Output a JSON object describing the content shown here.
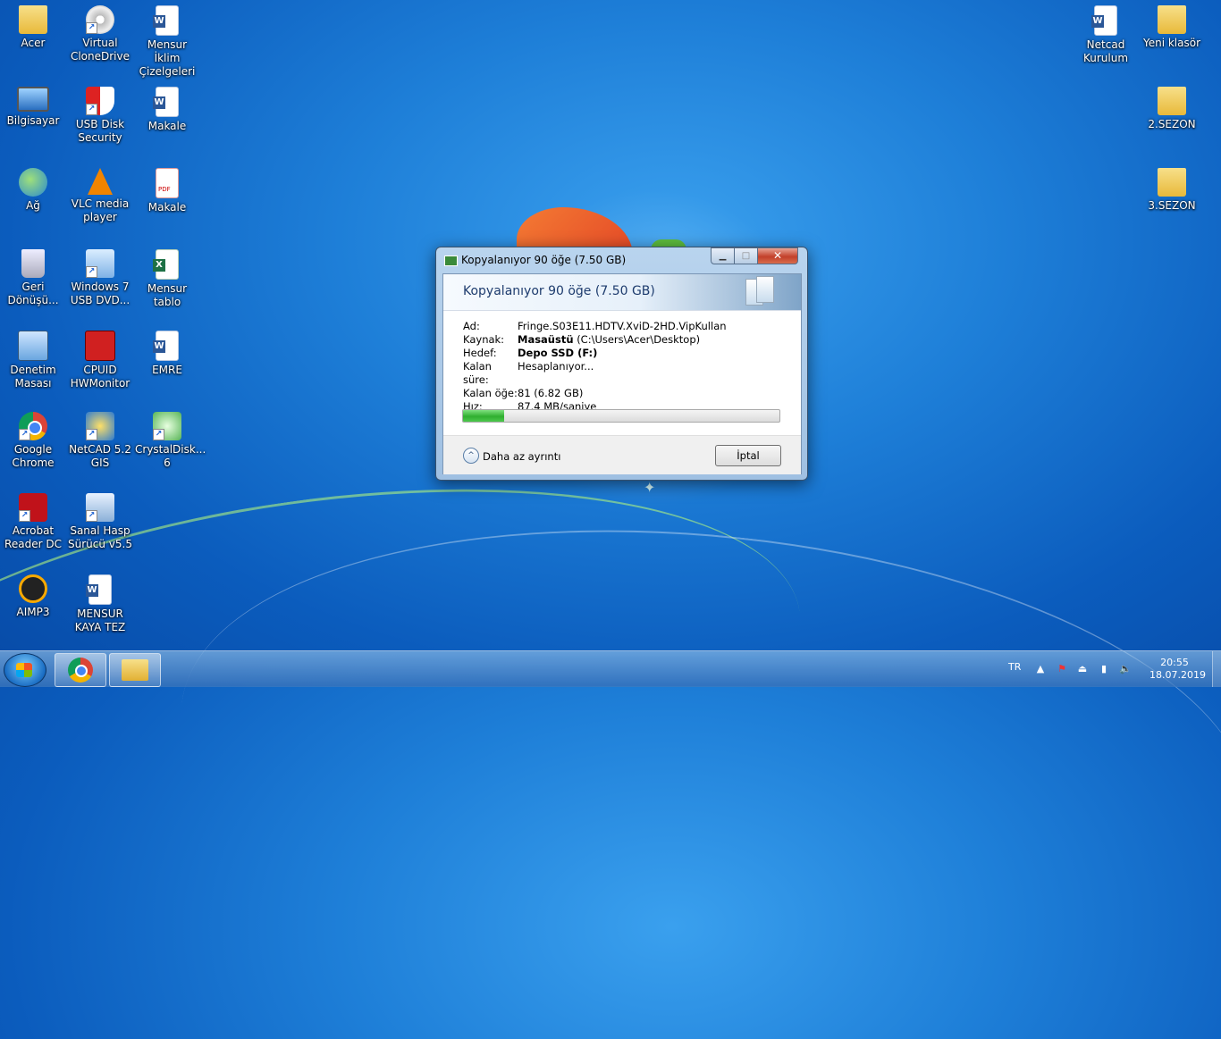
{
  "desktop_icons": [
    {
      "label": "Acer",
      "icon": "folder-icon"
    },
    {
      "label": "Virtual CloneDrive",
      "icon": "disc-icon"
    },
    {
      "label": "Mensur İklim Çizelgeleri",
      "icon": "word-document-icon"
    },
    {
      "label": "Bilgisayar",
      "icon": "computer-icon"
    },
    {
      "label": "USB Disk Security",
      "icon": "shield-icon"
    },
    {
      "label": "Makale",
      "icon": "word-document-icon"
    },
    {
      "label": "Ağ",
      "icon": "network-icon"
    },
    {
      "label": "VLC media player",
      "icon": "vlc-icon"
    },
    {
      "label": "Makale",
      "icon": "pdf-icon"
    },
    {
      "label": "Geri Dönüşü...",
      "icon": "recycle-bin-icon"
    },
    {
      "label": "Windows 7 USB DVD...",
      "icon": "usb-dvd-tool-icon"
    },
    {
      "label": "Mensur tablo",
      "icon": "excel-document-icon"
    },
    {
      "label": "Denetim Masası",
      "icon": "control-panel-icon"
    },
    {
      "label": "CPUID HWMonitor",
      "icon": "cpuid-icon"
    },
    {
      "label": "EMRE",
      "icon": "word-document-icon"
    },
    {
      "label": "Google Chrome",
      "icon": "chrome-icon"
    },
    {
      "label": "NetCAD 5.2 GIS",
      "icon": "netcad-icon"
    },
    {
      "label": "CrystalDisk... 6",
      "icon": "crystaldisk-icon"
    },
    {
      "label": "Acrobat Reader DC",
      "icon": "acrobat-icon"
    },
    {
      "label": "Sanal Hasp Sürücü v5.5",
      "icon": "hasp-icon"
    },
    {
      "label": "AIMP3",
      "icon": "aimp-icon"
    },
    {
      "label": "MENSUR KAYA TEZ",
      "icon": "word-document-icon"
    },
    {
      "label": "Netcad Kurulum",
      "icon": "word-document-icon"
    },
    {
      "label": "Yeni klasör",
      "icon": "folder-icon"
    },
    {
      "label": "2.SEZON",
      "icon": "folder-icon"
    },
    {
      "label": "3.SEZON",
      "icon": "folder-icon"
    }
  ],
  "dialog": {
    "title": "Kopyalanıyor 90 öğe (7.50 GB)",
    "header": "Kopyalanıyor 90 öğe (7.50 GB)",
    "minimize_glyph": "▁",
    "maximize_glyph": "□",
    "close_glyph": "✕",
    "rows": {
      "name_label": "Ad:",
      "name_value": "Fringe.S03E11.HDTV.XviD-2HD.VipKullan",
      "source_label": "Kaynak:",
      "source_bold": "Masaüstü",
      "source_path": "(C:\\Users\\Acer\\Desktop)",
      "dest_label": "Hedef:",
      "dest_value": "Depo SSD (F:)",
      "time_label": "Kalan süre:",
      "time_value": "Hesaplanıyor...",
      "items_label": "Kalan öğe:",
      "items_value": "81 (6.82 GB)",
      "speed_label": "Hız:",
      "speed_value": "87.4 MB/saniye"
    },
    "progress_percent": 13,
    "more_details_label": "Daha az ayrıntı",
    "more_details_glyph": "^",
    "cancel_label": "İptal"
  },
  "taskbar": {
    "pinned": [
      "chrome-icon",
      "explorer-folder-icon"
    ],
    "language": "TR",
    "tray_icons": [
      "show-hidden-icon",
      "network-warning-icon",
      "usb-safely-remove-icon",
      "signal-bars-icon",
      "volume-icon"
    ],
    "time": "20:55",
    "date": "18.07.2019"
  }
}
